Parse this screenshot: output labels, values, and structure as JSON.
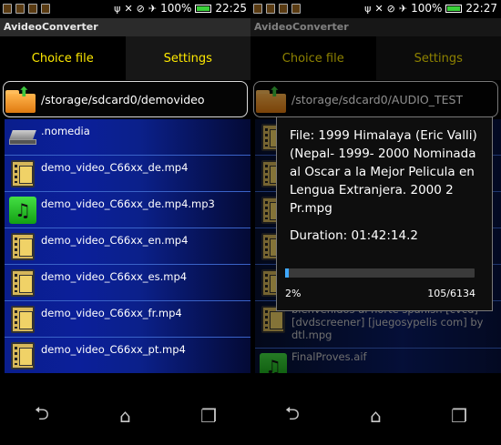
{
  "status_bar": {
    "battery_pct": "100%",
    "time_left": "22:25",
    "time_right": "22:27"
  },
  "app": {
    "title": "AvideoConverter"
  },
  "tabs": {
    "choice": "Choice file",
    "settings": "Settings"
  },
  "left": {
    "path": "/storage/sdcard0/demovideo",
    "files": [
      {
        "name": ".nomedia",
        "icon": "drive-icon"
      },
      {
        "name": "demo_video_C66xx_de.mp4",
        "icon": "video-file-icon"
      },
      {
        "name": "demo_video_C66xx_de.mp4.mp3",
        "icon": "music-file-icon"
      },
      {
        "name": "demo_video_C66xx_en.mp4",
        "icon": "video-file-icon"
      },
      {
        "name": "demo_video_C66xx_es.mp4",
        "icon": "video-file-icon"
      },
      {
        "name": "demo_video_C66xx_fr.mp4",
        "icon": "video-file-icon"
      },
      {
        "name": "demo_video_C66xx_pt.mp4",
        "icon": "video-file-icon"
      }
    ]
  },
  "right": {
    "path": "/storage/sdcard0/AUDIO_TEST",
    "files_visible": [
      {
        "name": "bienvenidos al norte spanish [cvcd] [dvdscreener] [juegosypelis com] by dtl.mpg"
      },
      {
        "name": "FinalProves.aif"
      }
    ],
    "dialog": {
      "file_line": "File: 1999 Himalaya (Eric Valli) (Nepal- 1999- 2000 Nominada al Oscar a la Mejor Pelicula en Lengua Extranjera. 2000 2 Pr.mpg",
      "duration_line": "Duration: 01:42:14.2",
      "progress_text": "2%",
      "progress_fraction": 0.02,
      "count_text": "105/6134"
    }
  },
  "icons": {
    "notif_icons": [
      "notification-icon",
      "notification-icon",
      "notification-icon",
      "notification-icon"
    ],
    "status": [
      "usb-icon",
      "mute-icon",
      "wifi-off-icon",
      "airplane-icon",
      "battery-icon"
    ],
    "nav": [
      "back-icon",
      "home-icon",
      "recents-icon"
    ]
  },
  "colors": {
    "tab_text": "#ffea00",
    "list_bg": "#0b1f9a",
    "progress": "#3fa8ff"
  }
}
